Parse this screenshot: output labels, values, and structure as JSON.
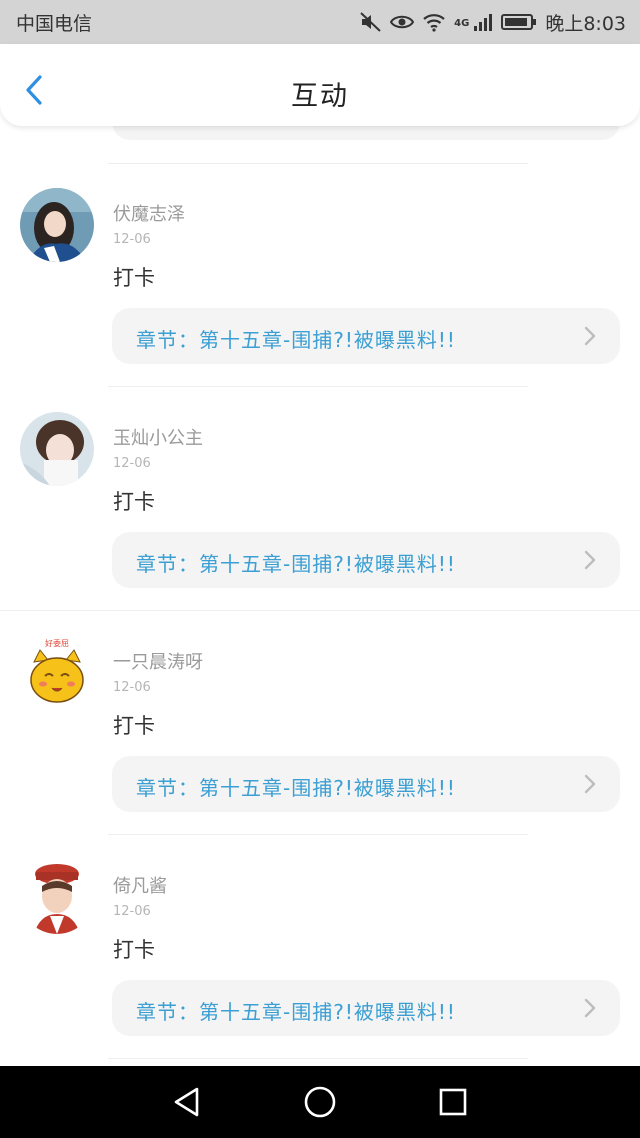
{
  "status_bar": {
    "carrier": "中国电信",
    "network": "4G",
    "time": "晚上8:03"
  },
  "header": {
    "title": "互动",
    "back_icon": "chevron-left-icon"
  },
  "colors": {
    "accent": "#3b9fd3",
    "back": "#2f8fe0",
    "card_bg": "#f4f4f4"
  },
  "posts": [
    {
      "name": "伏魔志泽",
      "date": "12-06",
      "content": "打卡",
      "chapter": "章节：第十五章-围捕?!被曝黑料!!",
      "avatar": "girl-photo"
    },
    {
      "name": "玉灿小公主",
      "date": "12-06",
      "content": "打卡",
      "chapter": "章节：第十五章-围捕?!被曝黑料!!",
      "avatar": "girl-photo"
    },
    {
      "name": "一只晨涛呀",
      "date": "12-06",
      "content": "打卡",
      "chapter": "章节：第十五章-围捕?!被曝黑料!!",
      "avatar": "cat-sticker",
      "avatar_caption": "好委屈"
    },
    {
      "name": "倚凡酱",
      "date": "12-06",
      "content": "打卡",
      "chapter": "章节：第十五章-围捕?!被曝黑料!!",
      "avatar": "boy-cap-illustration"
    }
  ],
  "nav_bar": [
    "back-triangle-icon",
    "home-circle-icon",
    "recents-square-icon"
  ]
}
